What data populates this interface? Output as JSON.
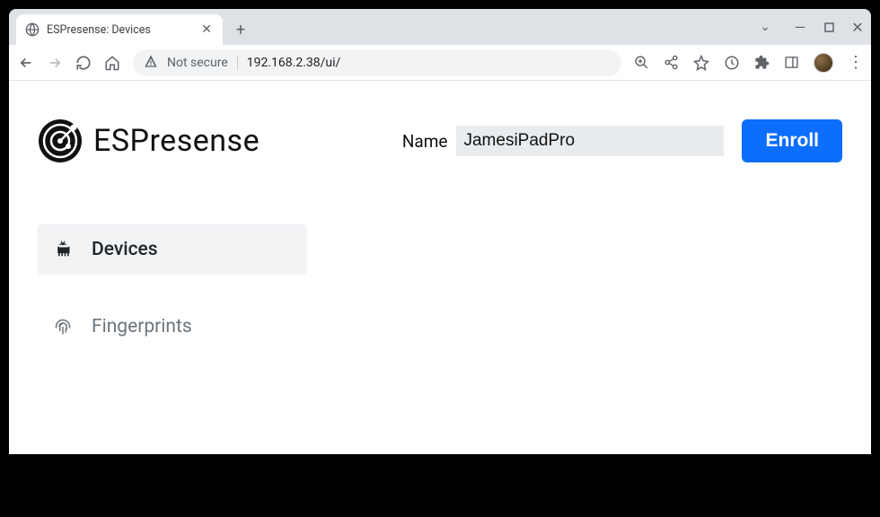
{
  "browser": {
    "tab_title": "ESPresense: Devices",
    "security_label": "Not secure",
    "url": "192.168.2.38/ui/"
  },
  "app": {
    "title": "ESPresense",
    "form": {
      "name_label": "Name",
      "name_value": "JamesiPadPro",
      "enroll_label": "Enroll"
    },
    "nav": {
      "items": [
        {
          "label": "Devices",
          "icon": "android-icon",
          "active": true
        },
        {
          "label": "Fingerprints",
          "icon": "fingerprint-icon",
          "active": false
        }
      ]
    }
  }
}
